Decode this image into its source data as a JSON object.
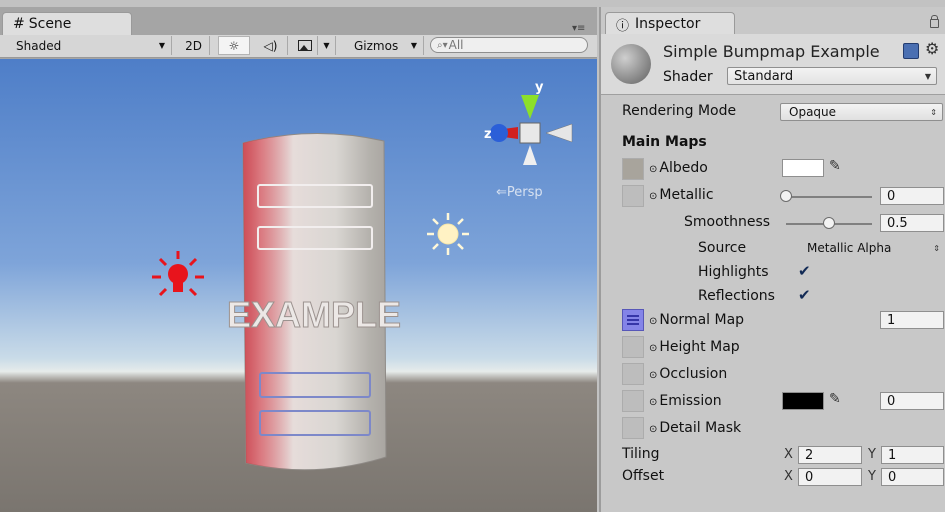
{
  "scene": {
    "tab_title": "Scene",
    "toolbar": {
      "draw_mode": "Shaded",
      "btn_2d": "2D",
      "gizmos": "Gizmos",
      "search_placeholder": "All"
    },
    "viewport": {
      "persp_label": "Persp",
      "object_text": "EXAMPLE",
      "gizmo_axes": [
        "y",
        "z"
      ]
    }
  },
  "inspector": {
    "tab_title": "Inspector",
    "material_name": "Simple Bumpmap Example",
    "shader_label": "Shader",
    "shader_value": "Standard",
    "rendering_mode": {
      "label": "Rendering Mode",
      "value": "Opaque"
    },
    "section_main_maps": "Main Maps",
    "albedo": {
      "label": "Albedo",
      "color": "#ffffff"
    },
    "metallic": {
      "label": "Metallic",
      "value": "0",
      "slider_fraction": 0
    },
    "smoothness": {
      "label": "Smoothness",
      "value": "0.5",
      "slider_fraction": 0.5
    },
    "source": {
      "label": "Source",
      "value": "Metallic Alpha"
    },
    "highlights": {
      "label": "Highlights",
      "checked": true
    },
    "reflections": {
      "label": "Reflections",
      "checked": true
    },
    "normal_map": {
      "label": "Normal Map",
      "value": "1"
    },
    "height_map": {
      "label": "Height Map"
    },
    "occlusion": {
      "label": "Occlusion"
    },
    "emission": {
      "label": "Emission",
      "value": "0",
      "color": "#000000"
    },
    "detail_mask": {
      "label": "Detail Mask"
    },
    "tiling": {
      "label": "Tiling",
      "x": "2",
      "y": "1"
    },
    "offset": {
      "label": "Offset",
      "x": "0",
      "y": "0"
    },
    "axis_x": "X",
    "axis_y": "Y"
  }
}
